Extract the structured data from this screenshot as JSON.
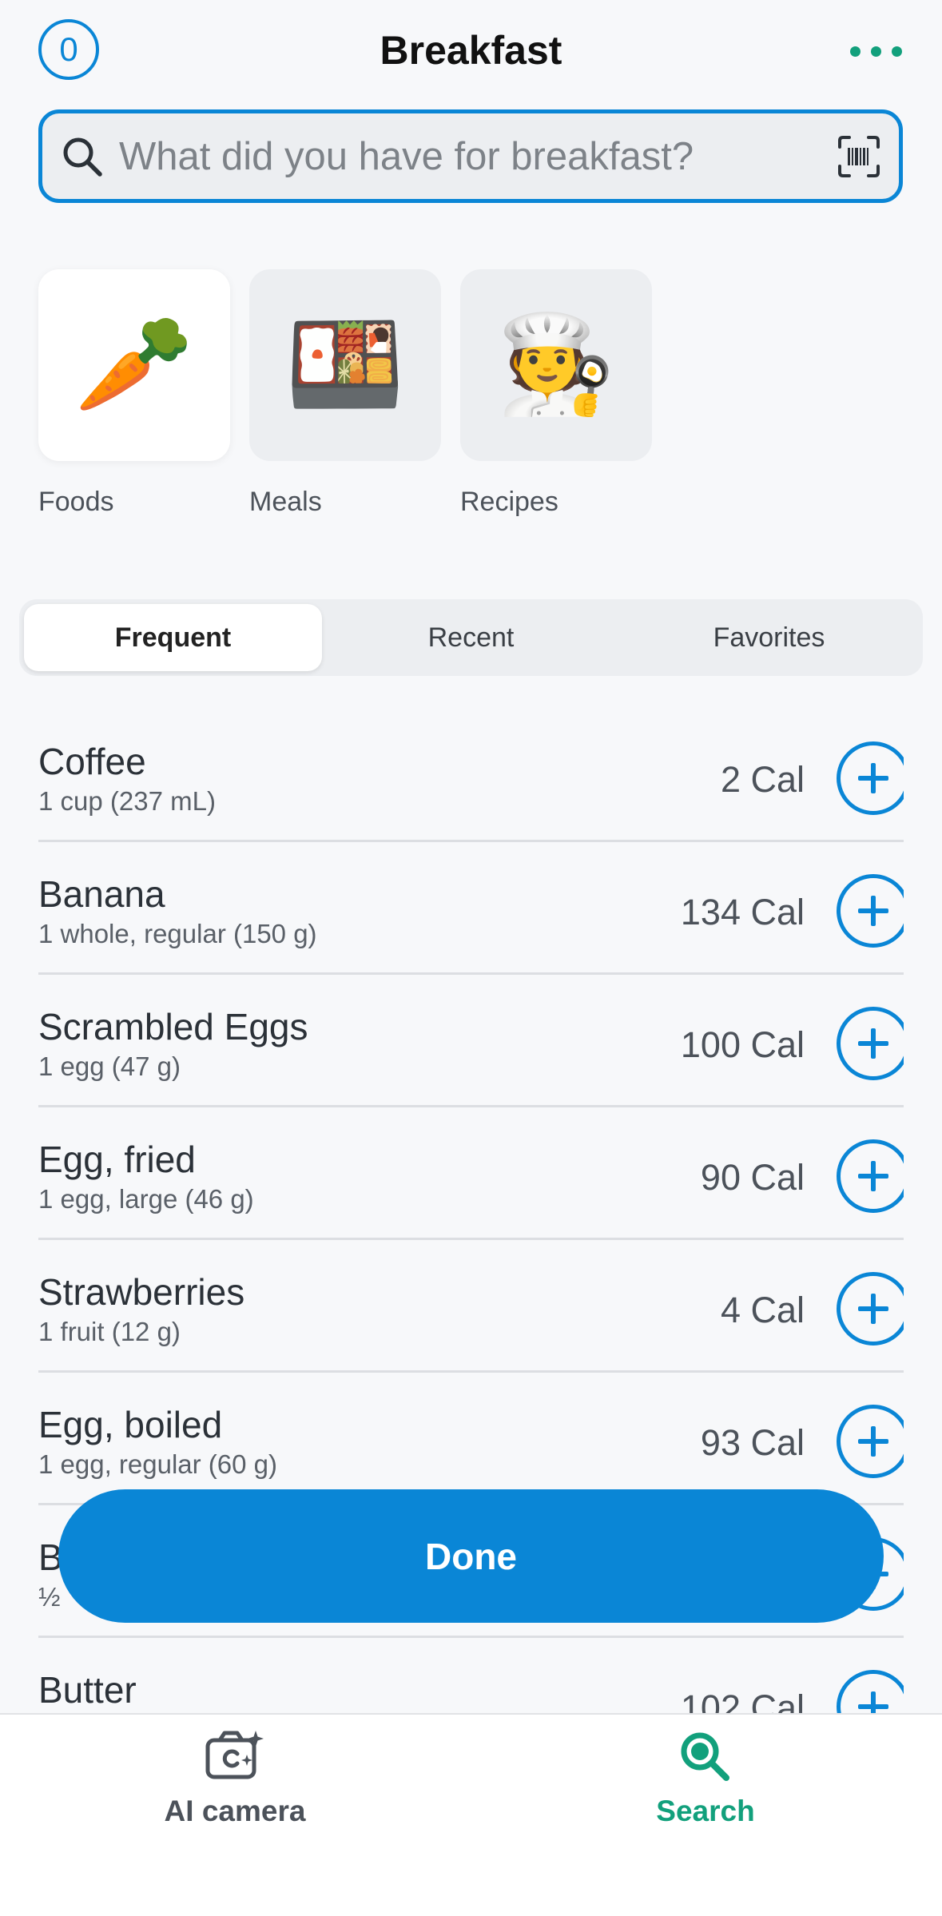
{
  "header": {
    "counter": "0",
    "title": "Breakfast"
  },
  "search": {
    "placeholder": "What did you have for breakfast?",
    "value": ""
  },
  "categories": [
    {
      "label": "Foods",
      "emoji": "🥕"
    },
    {
      "label": "Meals",
      "emoji": "🍱"
    },
    {
      "label": "Recipes",
      "emoji": "🧑‍🍳"
    }
  ],
  "segments": [
    "Frequent",
    "Recent",
    "Favorites"
  ],
  "foods": [
    {
      "name": "Coffee",
      "serving": "1 cup (237 mL)",
      "cal": "2 Cal"
    },
    {
      "name": "Banana",
      "serving": "1 whole, regular (150 g)",
      "cal": "134 Cal"
    },
    {
      "name": "Scrambled Eggs",
      "serving": "1 egg (47 g)",
      "cal": "100 Cal"
    },
    {
      "name": "Egg, fried",
      "serving": "1 egg, large (46 g)",
      "cal": "90 Cal"
    },
    {
      "name": "Strawberries",
      "serving": "1 fruit (12 g)",
      "cal": "4 Cal"
    },
    {
      "name": "Egg, boiled",
      "serving": "1 egg, regular (60 g)",
      "cal": "93 Cal"
    },
    {
      "name": "B",
      "serving": "½",
      "cal": ""
    },
    {
      "name": "Butter",
      "serving": "",
      "cal": "102 Cal"
    }
  ],
  "done_label": "Done",
  "tabbar": {
    "camera_label": "AI camera",
    "search_label": "Search"
  },
  "colors": {
    "accent": "#0a86d6",
    "active_tab": "#12a07c"
  }
}
